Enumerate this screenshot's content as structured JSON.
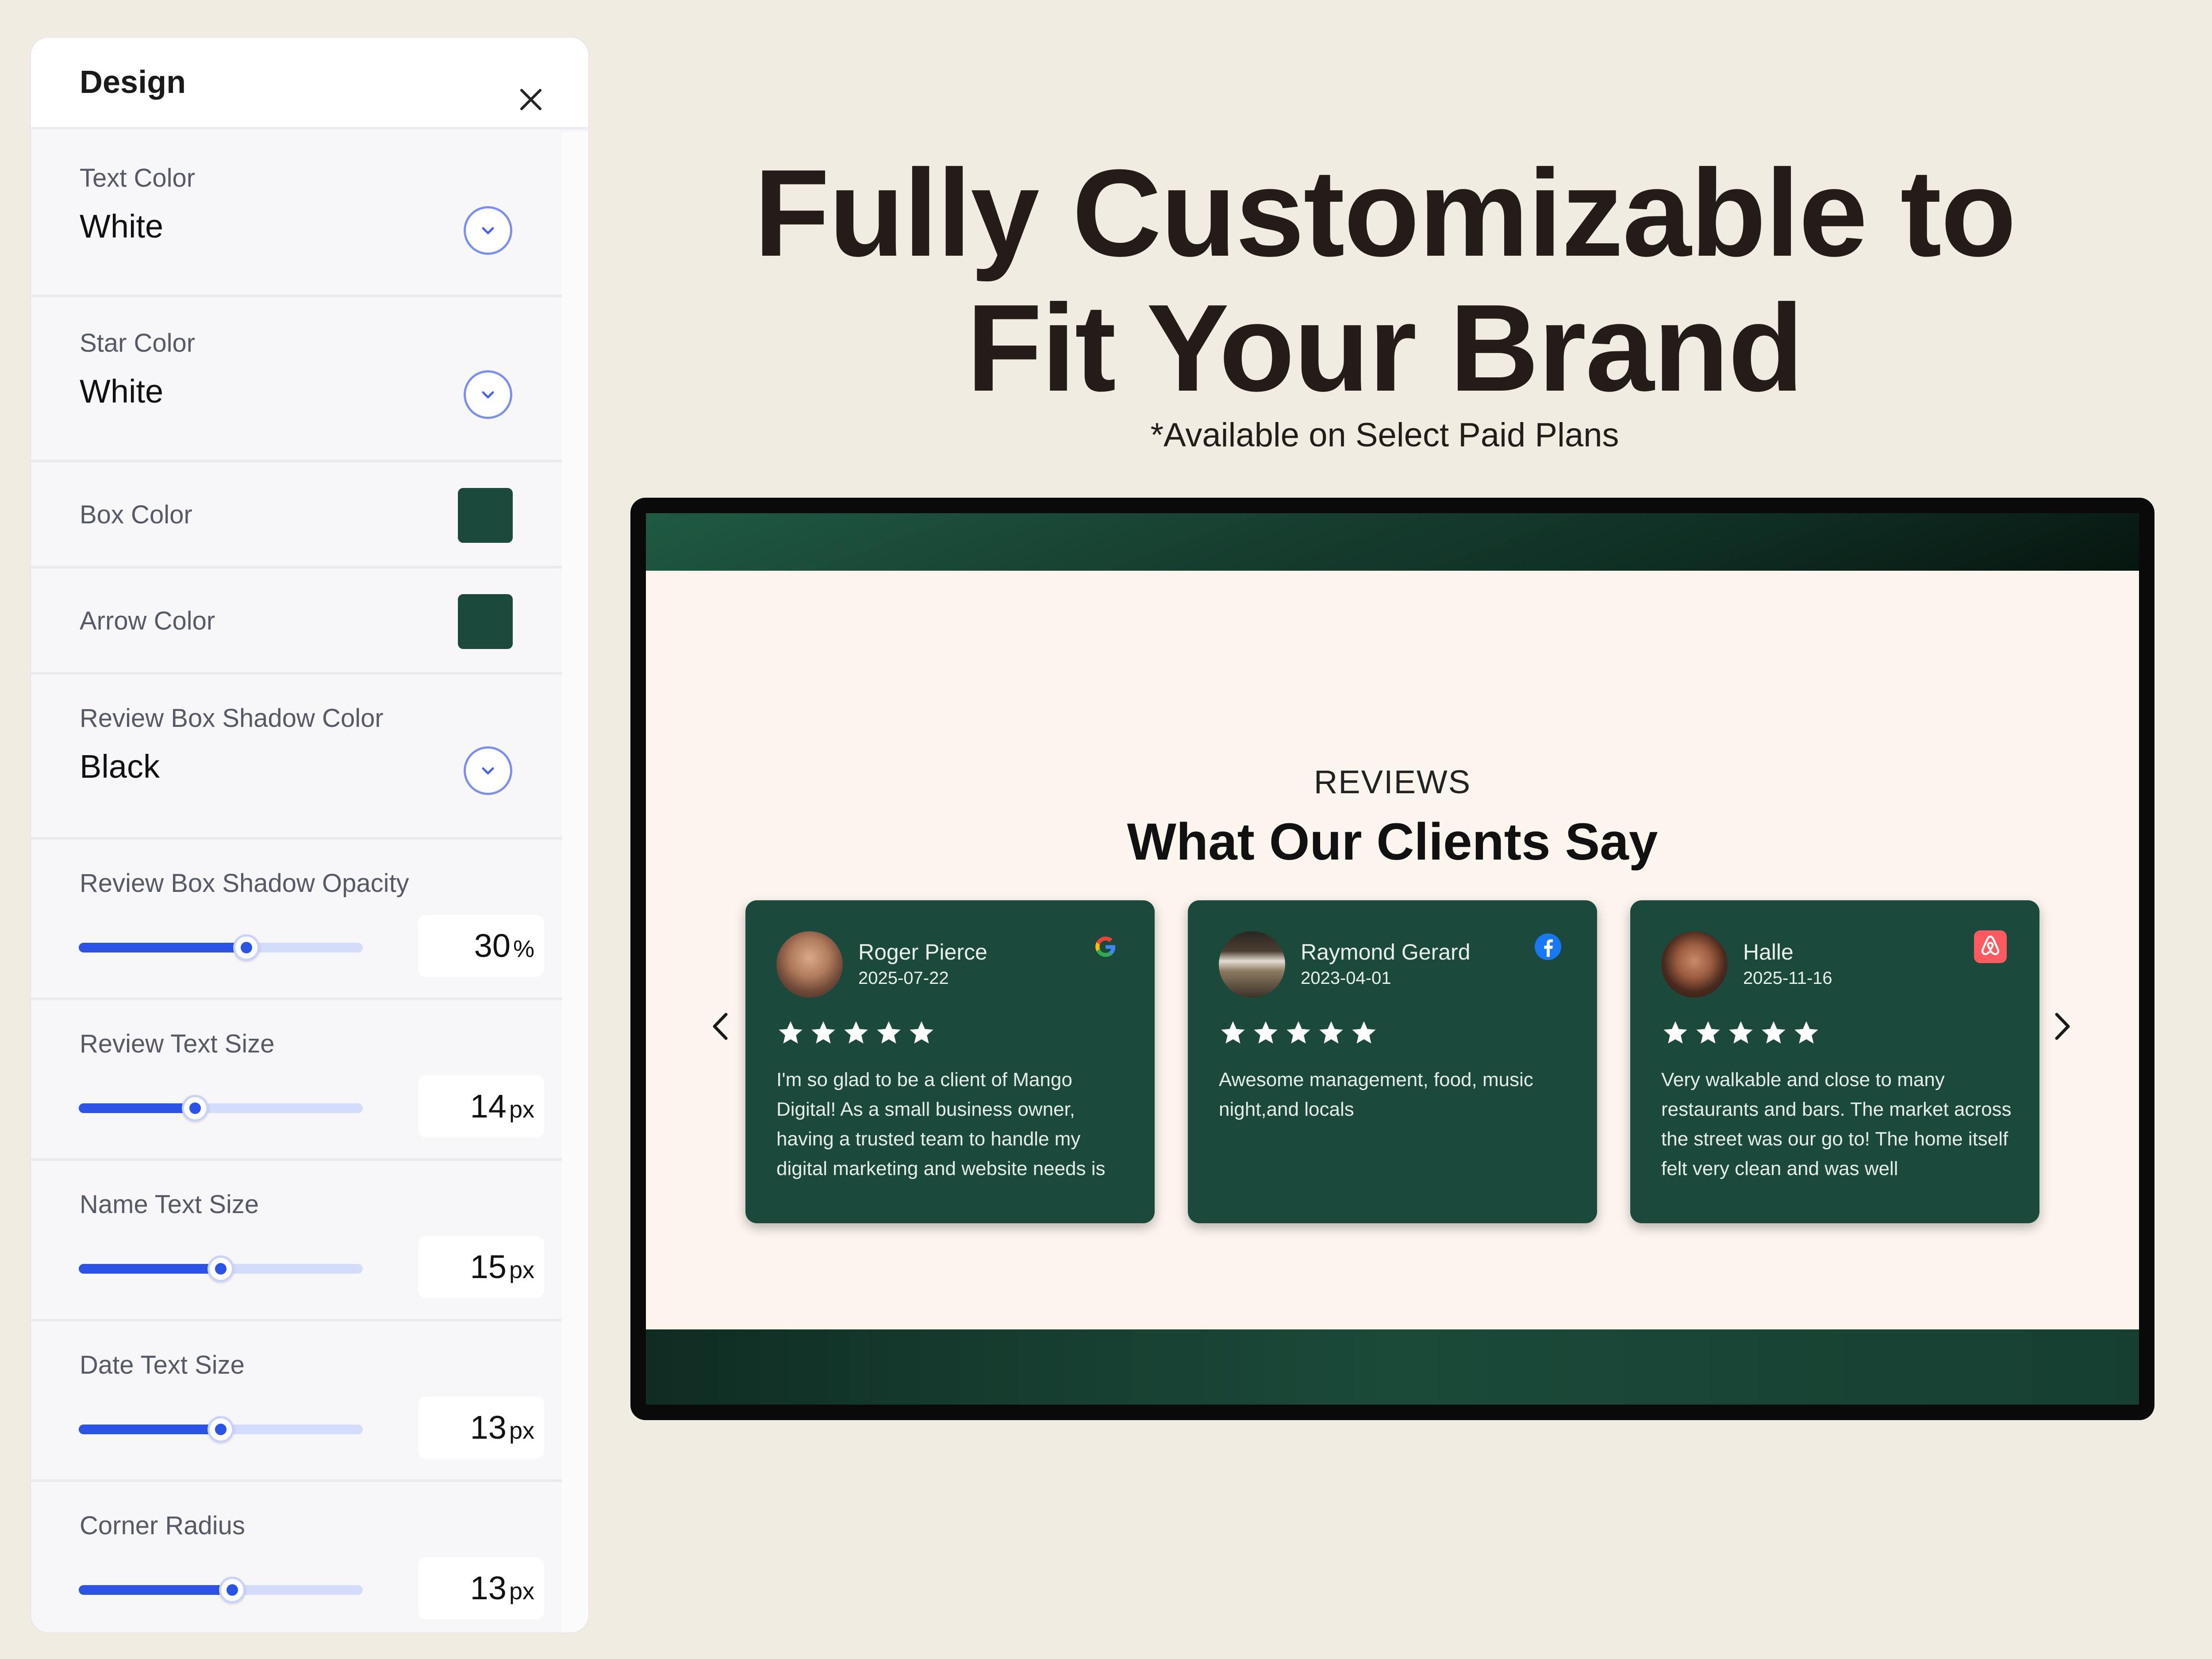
{
  "design_panel": {
    "title": "Design",
    "sections": [
      {
        "kind": "dropdown",
        "label": "Text Color",
        "value": "White"
      },
      {
        "kind": "dropdown",
        "label": "Star Color",
        "value": "White"
      },
      {
        "kind": "swatch",
        "label": "Box Color",
        "color": "#1b4a3d"
      },
      {
        "kind": "swatch",
        "label": "Arrow Color",
        "color": "#1b4a3d"
      },
      {
        "kind": "dropdown",
        "label": "Review Box Shadow Color",
        "value": "Black"
      },
      {
        "kind": "slider",
        "label": "Review Box Shadow Opacity",
        "value": "30",
        "unit": "%",
        "fraction": 0.59
      },
      {
        "kind": "slider",
        "label": "Review Text Size",
        "value": "14",
        "unit": "px",
        "fraction": 0.41
      },
      {
        "kind": "slider",
        "label": "Name Text Size",
        "value": "15",
        "unit": "px",
        "fraction": 0.5
      },
      {
        "kind": "slider",
        "label": "Date Text Size",
        "value": "13",
        "unit": "px",
        "fraction": 0.5
      },
      {
        "kind": "slider",
        "label": "Corner Radius",
        "value": "13",
        "unit": "px",
        "fraction": 0.54
      }
    ]
  },
  "headline": {
    "line1": "Fully Customizable to",
    "line2": "Fit Your Brand",
    "note": "*Available on Select Paid Plans"
  },
  "preview": {
    "kicker": "REVIEWS",
    "title": "What Our Clients Say",
    "star_color": "#ffffff",
    "reviews": [
      {
        "name": "Roger Pierce",
        "date": "2025-07-22",
        "platform": "google-icon",
        "stars": 5,
        "text": "I'm so glad to be a client of Mango Digital! As a small business owner, having a trusted team to handle my digital marketing and website needs is"
      },
      {
        "name": "Raymond Gerard",
        "date": "2023-04-01",
        "platform": "facebook-icon",
        "stars": 5,
        "text": "Awesome management, food, music night,and locals"
      },
      {
        "name": "Halle",
        "date": "2025-11-16",
        "platform": "airbnb-icon",
        "stars": 5,
        "text": "Very walkable and close to many restaurants and bars. The market across the street was our go to! The home itself felt very clean and was well"
      }
    ]
  }
}
